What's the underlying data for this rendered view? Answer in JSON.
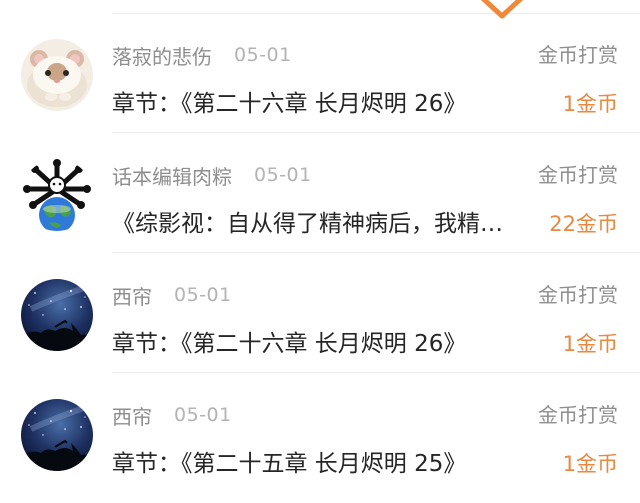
{
  "colors": {
    "accent": "#e9883e",
    "username": "#8e8e8e",
    "date": "#b3b3b3",
    "content": "#262626",
    "divider": "#ececec"
  },
  "top": {
    "icon": "chevron-down-icon"
  },
  "rows": [
    {
      "avatar": "hamster-avatar",
      "username": "落寂的悲伤",
      "date": "05-01",
      "content": "章节：《第二十六章 长月烬明 26》",
      "action": "金币打赏",
      "reward": "1金币"
    },
    {
      "avatar": "earth-avatar",
      "username": "话本编辑肉粽",
      "date": "05-01",
      "content": "《综影视：自从得了精神病后，我精神状态好多了》",
      "action": "金币打赏",
      "reward": "22金币"
    },
    {
      "avatar": "night-sky-avatar",
      "username": "西帘",
      "date": "05-01",
      "content": "章节：《第二十六章 长月烬明 26》",
      "action": "金币打赏",
      "reward": "1金币"
    },
    {
      "avatar": "night-sky-avatar",
      "username": "西帘",
      "date": "05-01",
      "content": "章节：《第二十五章 长月烬明 25》",
      "action": "金币打赏",
      "reward": "1金币"
    }
  ]
}
